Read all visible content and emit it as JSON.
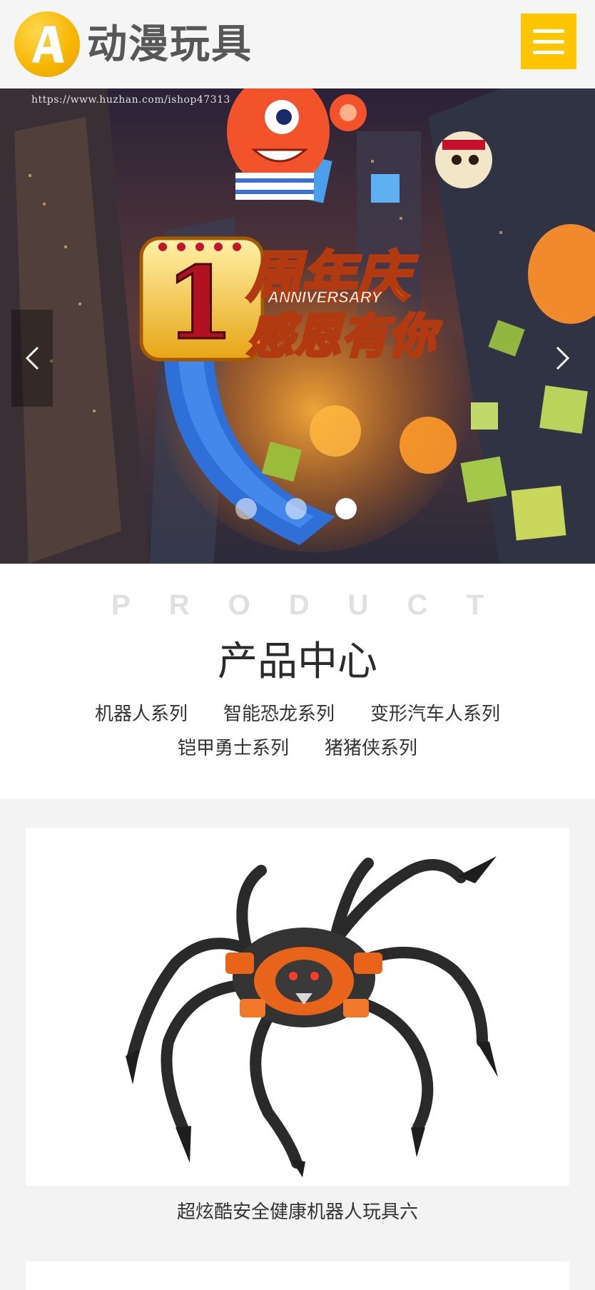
{
  "header": {
    "logo_letter": "A",
    "logo_text": "动漫玩具",
    "menu_icon": "hamburger-icon"
  },
  "banner": {
    "watermark": "https://www.huzhan.com/ishop47313",
    "headline_number": "1",
    "headline_line1": "周年庆",
    "headline_sub": "ANNIVERSARY",
    "headline_line2": "感恩有你",
    "prev_icon": "chevron-left-icon",
    "next_icon": "chevron-right-icon",
    "slides_total": 3,
    "active_slide": 3
  },
  "product": {
    "title_en": "PRODUCT",
    "title_cn": "产品中心",
    "categories_row1": [
      "机器人系列",
      "智能恐龙系列",
      "变形汽车人系列"
    ],
    "categories_row2": [
      "铠甲勇士系列",
      "猪猪侠系列"
    ]
  },
  "items": [
    {
      "title": "超炫酷安全健康机器人玩具六"
    }
  ],
  "colors": {
    "accent": "#ffc600",
    "page_bg": "#f3f3f3"
  }
}
